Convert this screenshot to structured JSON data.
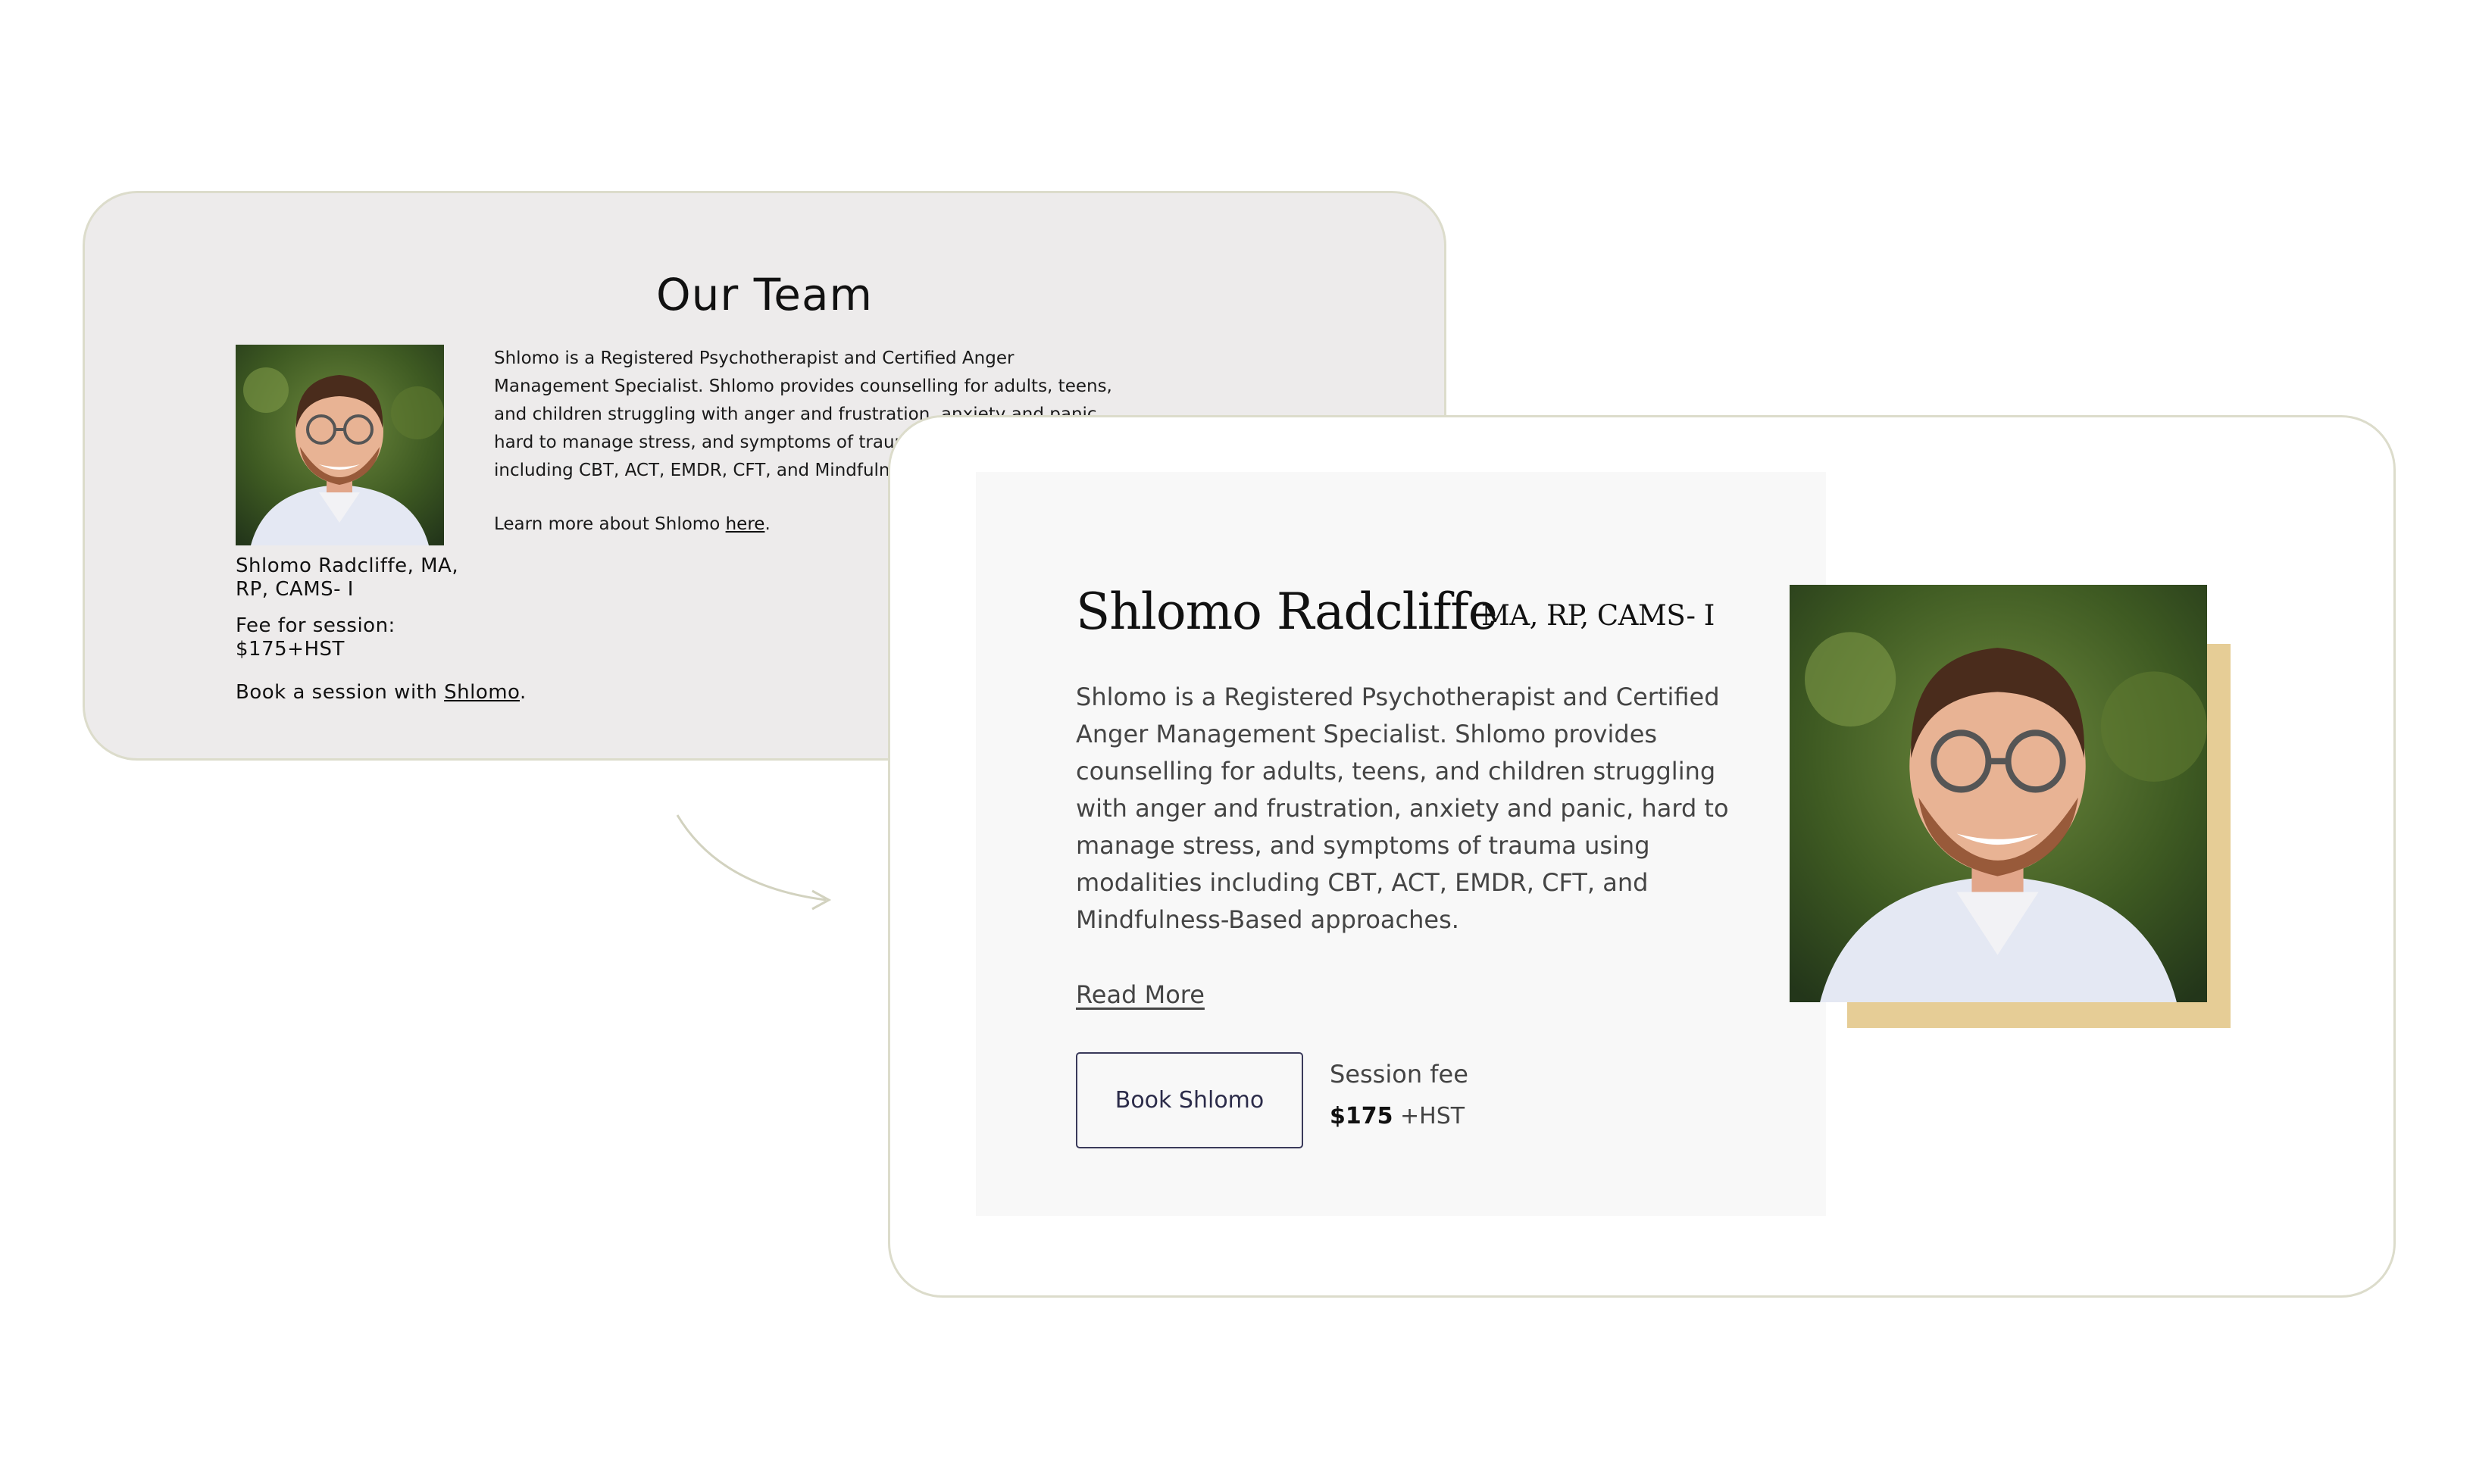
{
  "before": {
    "title": "Our Team",
    "name": "Shlomo Radcliffe, MA, RP, CAMS- I",
    "fee_label": "Fee for session:",
    "fee_value": "$175+HST",
    "book_prefix": "Book a session with ",
    "book_link": "Shlomo",
    "book_suffix": ".",
    "bio": "Shlomo is a Registered Psychotherapist and Certified Anger Management Specialist. Shlomo provides counselling for adults, teens, and children struggling with anger and frustration, anxiety and panic, hard to manage stress, and symptoms of trauma using modalities including CBT, ACT, EMDR, CFT, and Mindfulness-Based approaches.",
    "learn_prefix": "Learn more about Shlomo ",
    "learn_link": "here",
    "learn_suffix": "."
  },
  "after": {
    "name": "Shlomo Radcliffe",
    "credentials": "MA, RP, CAMS- I",
    "bio": "Shlomo is a Registered Psychotherapist and Certified Anger Management Specialist. Shlomo provides counselling for adults, teens, and children struggling with anger and frustration, anxiety and panic, hard to manage stress, and symptoms of trauma using modalities including CBT, ACT, EMDR, CFT, and Mindfulness-Based approaches.",
    "read_more": "Read More",
    "book_button": "Book Shlomo",
    "fee_label": "Session fee",
    "fee_price": "$175",
    "fee_tax": " +HST"
  },
  "colors": {
    "before_card_bg": "#edebeb",
    "card_border": "#dcdccb",
    "panel_bg": "#f8f8f8",
    "photo_shadow": "#e6cd96",
    "button_border": "#3a3a5a"
  },
  "icons": {
    "arrow": "curved-arrow-icon",
    "photo": "headshot-photo"
  }
}
